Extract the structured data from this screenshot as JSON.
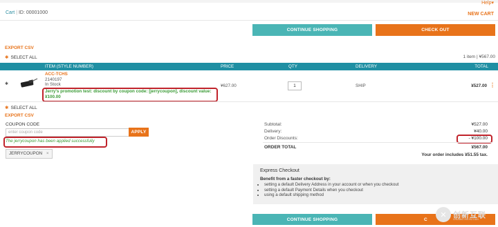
{
  "header": {
    "help": "Help",
    "cart_label": "Cart",
    "cart_id": "ID: 00001000",
    "new_cart": "NEW CART"
  },
  "actions": {
    "continue_shopping": "CONTINUE SHOPPING",
    "check_out": "CHECK OUT",
    "check_out_bottom_partial": "C"
  },
  "export_csv": "EXPORT CSV",
  "select_all": "SELECT ALL",
  "cart_summary": "1 item | ¥567.00",
  "table": {
    "columns": [
      "ITEM (STYLE NUMBER)",
      "PRICE",
      "QTY",
      "DELIVERY",
      "TOTAL"
    ],
    "item": {
      "code": "ACC-TCHS",
      "number": "2140197",
      "stock": "In Stock",
      "promo_line1": "Jerry's promotion test: discount by coupon code: [jerrycoupon], discount value:",
      "promo_line2": "¥100.00",
      "price": "¥627.00",
      "qty": "1",
      "delivery": "SHIP",
      "total": "¥527.00",
      "menu_icon": "kebab-menu-icon"
    }
  },
  "coupon": {
    "title": "COUPON CODE",
    "placeholder": "enter coupon code",
    "apply": "APPLY",
    "success": "The jerrycoupon has been applied successfully",
    "tag": "JERRYCOUPON",
    "remove": "×"
  },
  "totals": {
    "subtotal_label": "Subtotal:",
    "subtotal": "¥527.00",
    "delivery_label": "Delivery:",
    "delivery": "¥40.00",
    "discounts_label": "Order Discounts:",
    "discounts": "- ¥100.00",
    "order_total_label": "ORDER TOTAL",
    "order_total": "¥567.00",
    "tax_note": "Your order includes ¥51.55 tax."
  },
  "express": {
    "title": "Express Checkout",
    "subtitle": "Benefit from a faster checkout by:",
    "items": [
      "setting a default Delivery Address in your account or when you checkout",
      "setting a default Payment Details when you checkout",
      "using a default shipping method"
    ]
  },
  "watermark": {
    "text": "创新互联",
    "sub": "CHUANG XIN HU LIAN"
  },
  "colors": {
    "accent_orange": "#e8731a",
    "teal": "#4ab5b5",
    "header_teal": "#1f8fa3",
    "highlight_red": "#c0222a",
    "success_green": "#3a9a35"
  }
}
